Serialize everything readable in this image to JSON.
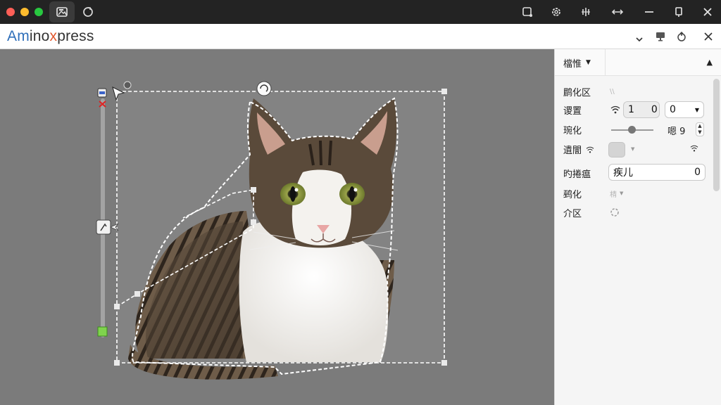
{
  "app": {
    "brand_a": "Am",
    "brand_b": "ino",
    "brand_c": "x",
    "brand_d": "press"
  },
  "titlebar": {
    "icons": [
      "image-edit-icon",
      "refresh-icon",
      "crop-icon",
      "settings-icon",
      "split-icon",
      "resize-icon",
      "minimize-icon",
      "restore-icon",
      "close-icon"
    ]
  },
  "header_icons": [
    "chevron-down-icon",
    "monitor-icon",
    "share-icon",
    "close-icon"
  ],
  "canvas": {
    "background": "#7b7b7b"
  },
  "panel": {
    "tab_label": "檔惟",
    "rows": [
      {
        "label": "鹛化区",
        "hint": "\\\\"
      },
      {
        "label": "谡置",
        "val1": "1",
        "val2": "0",
        "select": "0"
      },
      {
        "label": "琬化",
        "value": "嗯 9"
      },
      {
        "label": "遺闇"
      },
      {
        "label": "旳捲瘟",
        "input": "疾儿",
        "input_val": "0"
      },
      {
        "label": "鹀化",
        "hint": "棈"
      },
      {
        "label": "介区"
      }
    ]
  },
  "colors": {
    "accent": "#2f6fba",
    "brand_x": "#e2572d",
    "titlebar": "#232323"
  }
}
